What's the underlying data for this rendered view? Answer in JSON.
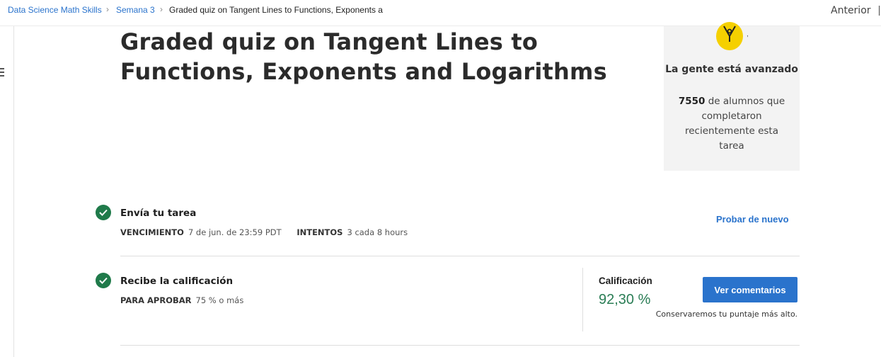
{
  "breadcrumb": {
    "items": [
      "Data Science Math Skills",
      "Semana 3",
      "Graded quiz on Tangent Lines to Functions, Exponents a"
    ]
  },
  "nav": {
    "previous_label": "Anterior"
  },
  "page": {
    "title": "Graded quiz on Tangent Lines to Functions, Exponents and Logarithms"
  },
  "progress_card": {
    "icon": "pen-nib-icon",
    "decor": ",",
    "heading": "La gente está avanzado",
    "count": "7550",
    "text": " de alumnos que completaron recientemente esta tarea",
    "badge_color": "#f5d000"
  },
  "submit_step": {
    "icon": "check-circle-icon",
    "title": "Envía tu tarea",
    "due_label": "VENCIMIENTO",
    "due_value": "7 de jun. de 23:59 PDT",
    "attempts_label": "INTENTOS",
    "attempts_value": "3 cada 8 hours",
    "retry_label": "Probar de nuevo"
  },
  "grade_step": {
    "icon": "check-circle-icon",
    "title": "Recibe la calificación",
    "pass_label": "PARA APROBAR",
    "pass_value": "75 % o más",
    "grade_label": "Calificación",
    "grade_value": "92,30 %",
    "feedback_button": "Ver comentarios",
    "note": "Conservaremos tu puntaje más alto."
  },
  "colors": {
    "accent": "#2a73cc",
    "success": "#1f7a4a",
    "grade": "#2a7d55"
  }
}
